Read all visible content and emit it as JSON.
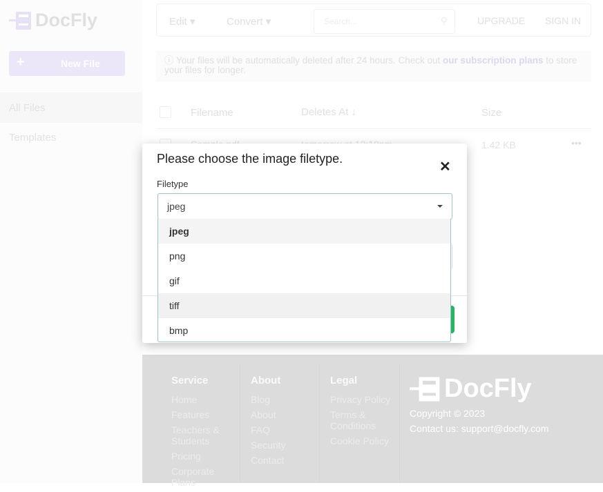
{
  "brand": {
    "name": "DocFly",
    "accent": "#e0dbf5"
  },
  "sidebar": {
    "new_file": "New File",
    "items": [
      {
        "label": "All Files"
      },
      {
        "label": "Templates"
      }
    ]
  },
  "topbar": {
    "edit": "Edit",
    "convert": "Convert",
    "search_placeholder": "Search...",
    "upgrade": "UPGRADE",
    "sign_in": "SIGN IN"
  },
  "notice": {
    "text": "Your files will be automatically deleted after 24 hours. Check out ",
    "link": "our subscription plans",
    "text2": " to store your files for longer."
  },
  "table": {
    "headers": [
      "Filename",
      "Deletes At",
      "Size"
    ],
    "sort_icon": "arrow-down",
    "rows": [
      {
        "filename": "Sample.pdf",
        "deletes_at": "tomorrow at 12:10pm",
        "size": "1.42 KB"
      }
    ]
  },
  "modal": {
    "title": "Please choose the image filetype.",
    "field_label": "Filetype",
    "selected": "jpeg",
    "options": [
      "jpeg",
      "png",
      "gif",
      "tiff",
      "bmp"
    ],
    "confirm_color": "#28b463"
  },
  "footer": {
    "columns": [
      {
        "title": "Service",
        "links": [
          "Home",
          "Features",
          "Teachers & Students",
          "Pricing",
          "Corporate Plans"
        ]
      },
      {
        "title": "About",
        "links": [
          "Blog",
          "About",
          "FAQ",
          "Security",
          "Contact"
        ]
      },
      {
        "title": "Legal",
        "links": [
          "Privacy Policy",
          "Terms & Conditions",
          "Cookie Policy"
        ]
      }
    ],
    "copyright": "Copyright © 2023",
    "contact": "Contact us: support@docfly.com"
  }
}
